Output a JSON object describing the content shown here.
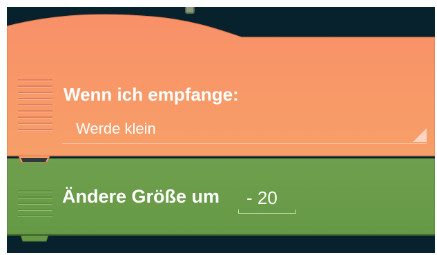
{
  "script": {
    "receive_block": {
      "title": "Wenn ich empfange:",
      "message_value": "Werde klein",
      "color": "#f79a66"
    },
    "change_size_block": {
      "label": "Ändere Größe um",
      "size_value": "- 20",
      "color": "#699e49"
    },
    "background_color": "#07222d"
  }
}
